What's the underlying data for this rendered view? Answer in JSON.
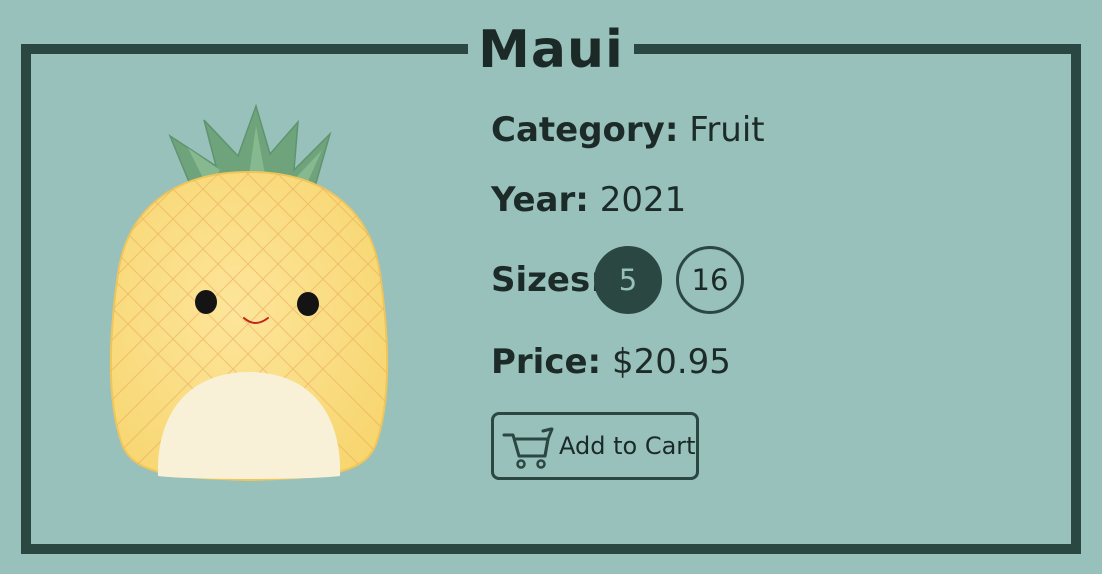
{
  "product": {
    "name": "Maui",
    "image_alt": "pineapple plush",
    "category_label": "Category:",
    "category_value": "Fruit",
    "year_label": "Year:",
    "year_value": "2021",
    "sizes_label": "Sizes:",
    "sizes": [
      {
        "label": "5",
        "selected": true
      },
      {
        "label": "16",
        "selected": false
      }
    ],
    "price_label": "Price:",
    "price_value": "$20.95",
    "add_to_cart_label": "Add to Cart"
  },
  "icons": {
    "cart": "shopping-cart-icon"
  },
  "colors": {
    "background": "#98c1bc",
    "frame": "#2b4742",
    "text": "#1d2b28",
    "selected_size_fill": "#2b4742",
    "selected_size_text": "#98c1bc"
  }
}
